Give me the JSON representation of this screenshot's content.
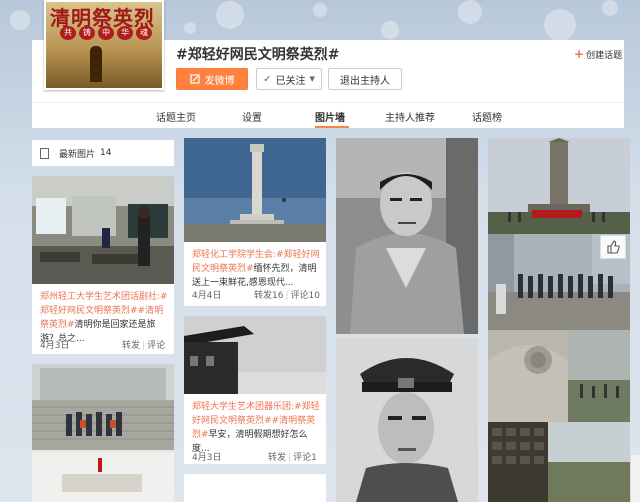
{
  "cover": {
    "title": "清明祭英烈",
    "badges": [
      "共",
      "铸",
      "中",
      "华",
      "魂"
    ]
  },
  "topic": {
    "title": "#郑轻好网民文明祭英烈#",
    "create_label": "创建话题"
  },
  "buttons": {
    "post": "发微博",
    "follow": "已关注",
    "quit": "退出主持人"
  },
  "tabs": [
    "话题主页",
    "设置",
    "图片墙",
    "主持人推荐",
    "话题榜"
  ],
  "latest": {
    "label": "最新图片",
    "count": "14"
  },
  "posts": [
    {
      "author": "郑州轻工大学生艺术团话剧社:",
      "topic": "#郑轻好网民文明祭英烈#",
      "topic2": "#清明祭英烈#",
      "text": "清明你是回家还是旅游？总之...",
      "date": "4月3日",
      "repost": "转发",
      "comment": "评论"
    },
    {
      "author": "郑轻化工学院学生会:",
      "topic": "#郑轻好网民文明祭英烈#",
      "text": "缅怀先烈，清明送上一束鲜花,感恩现代...",
      "date": "4月4日",
      "repost": "转发16",
      "comment": "评论10"
    },
    {
      "author": "郑轻大学生艺术团器乐团:",
      "topic": "#郑轻好网民文明祭英烈#",
      "topic2": "#清明祭英烈#",
      "text": "早安，清明假期想好怎么度...",
      "date": "4月3日",
      "repost": "转发",
      "comment": "评论1"
    }
  ],
  "colors": {
    "accent": "#ff8140",
    "link": "#eb7350"
  }
}
